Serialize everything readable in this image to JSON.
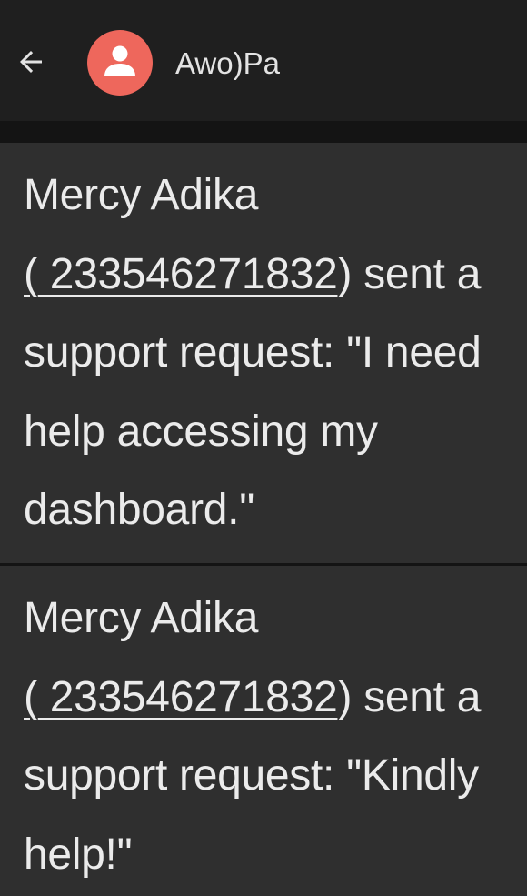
{
  "header": {
    "back_icon": "arrow-left-icon",
    "avatar_icon": "person-icon",
    "avatar_color": "#ee675c",
    "contact_name": "Awo)Pa"
  },
  "messages": [
    {
      "sender": "Mercy Adika",
      "phone_open": "(",
      "phone": " 233546271832",
      "phone_close": ")",
      "action": " sent a support request: ",
      "quote": "\"I need help accessing my dashboard.\""
    },
    {
      "sender": "Mercy Adika",
      "phone_open": "(",
      "phone": " 233546271832",
      "phone_close": ")",
      "action": " sent a support request: ",
      "quote": "\"Kindly help!\""
    }
  ],
  "colors": {
    "background": "#1f1f1f",
    "bubble": "#2f2f2f",
    "text": "#ebebeb"
  }
}
